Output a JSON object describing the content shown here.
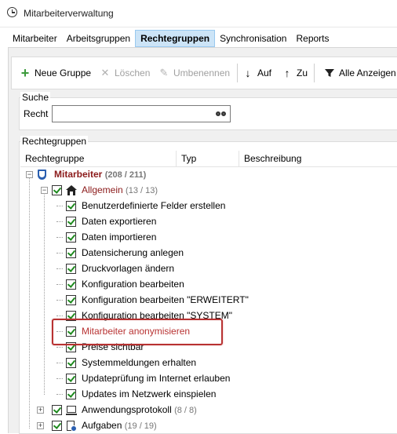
{
  "window": {
    "title": "Mitarbeiterverwaltung"
  },
  "menu": [
    {
      "label": "Mitarbeiter",
      "active": false
    },
    {
      "label": "Arbeitsgruppen",
      "active": false
    },
    {
      "label": "Rechtegruppen",
      "active": true
    },
    {
      "label": "Synchronisation",
      "active": false
    },
    {
      "label": "Reports",
      "active": false
    }
  ],
  "toolbar": {
    "new_group": "Neue Gruppe",
    "delete": "Löschen",
    "rename": "Umbenennen",
    "up": "Auf",
    "down": "Zu",
    "show_all": "Alle Anzeigen"
  },
  "search": {
    "group_label": "Suche",
    "field_label": "Recht",
    "value": ""
  },
  "tree": {
    "group_label": "Rechtegruppen",
    "columns": [
      "Rechtegruppe",
      "Typ",
      "Beschreibung"
    ],
    "root": {
      "label": "Mitarbeiter",
      "count": "(208 / 211)",
      "color": "#8b1a1a"
    },
    "child_allgemein": {
      "label": "Allgemein",
      "count": "(13 / 13)",
      "color": "#8b1a1a"
    },
    "items": [
      "Benutzerdefinierte Felder erstellen",
      "Daten exportieren",
      "Daten importieren",
      "Datensicherung anlegen",
      "Druckvorlagen ändern",
      "Konfiguration bearbeiten",
      "Konfiguration bearbeiten \"ERWEITERT\"",
      "Konfiguration bearbeiten \"SYSTEM\"",
      "Mitarbeiter anonymisieren",
      "Preise sichtbar",
      "Systemmeldungen erhalten",
      "Updateprüfung im Internet erlauben",
      "Updates im Netzwerk einspielen"
    ],
    "highlighted_item_color": "#b83232",
    "child_anwendungsprotokoll": {
      "label": "Anwendungsprotokoll",
      "count": "(8 / 8)"
    },
    "child_aufgaben": {
      "label": "Aufgaben",
      "count": "(19 / 19)"
    }
  }
}
